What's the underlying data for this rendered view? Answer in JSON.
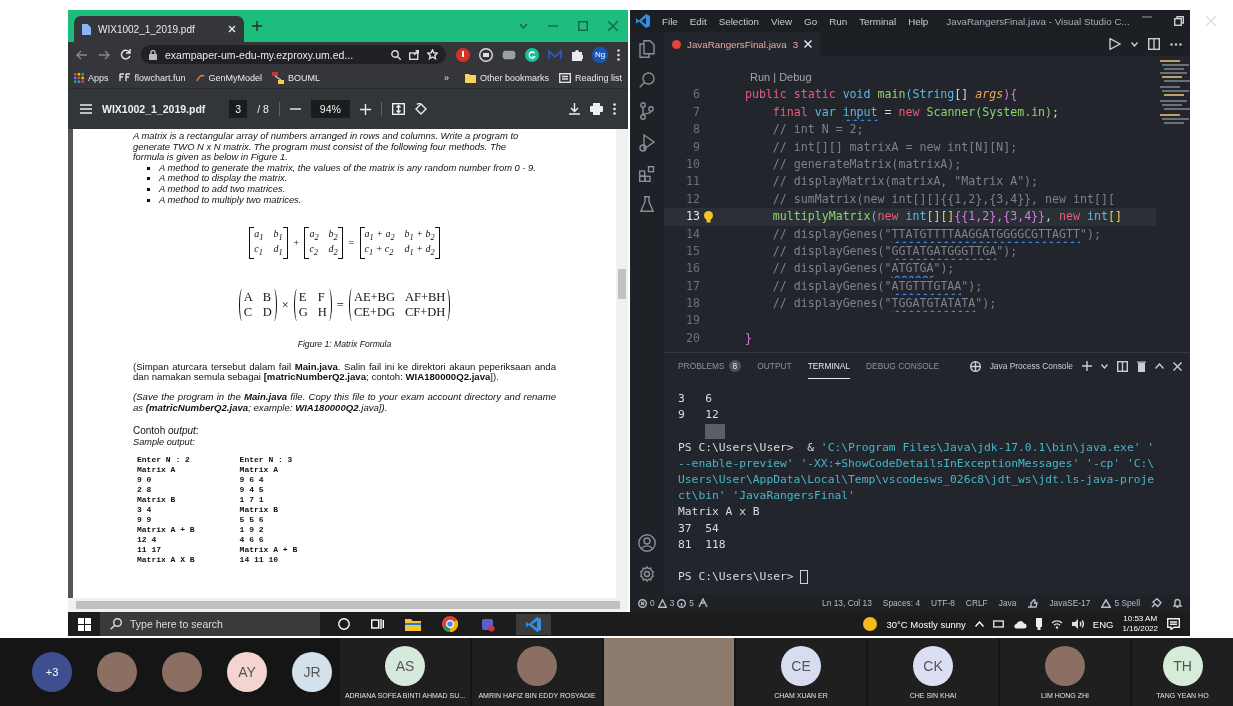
{
  "browser": {
    "tab_title": "WIX1002_1_2019.pdf",
    "url": "exampaper-um-edu-my.ezproxy.um.ed...",
    "profile": "Ng",
    "bookmarks": [
      {
        "label": "Apps",
        "kind": "apps"
      },
      {
        "label": "flowchart.fun",
        "kind": "ff"
      },
      {
        "label": "GenMyModel",
        "kind": "gen"
      },
      {
        "label": "BOUML",
        "kind": "bouml"
      }
    ],
    "overflow": "»",
    "bookmarks_right": [
      {
        "label": "Other bookmarks",
        "kind": "folder"
      },
      {
        "label": "Reading list",
        "kind": "reading"
      }
    ]
  },
  "pdf_toolbar": {
    "title": "WIX1002_1_2019.pdf",
    "page": "3",
    "page_total": "/ 8",
    "zoom": "94%"
  },
  "pdf_page": {
    "intro": [
      "A matrix is a rectangular array of numbers arranged in rows and columns. Write a program to",
      "generate TWO N x N matrix. The program must consist of the following four methods. The",
      "formula is given as below in Figure 1."
    ],
    "bullets": [
      "A method to generate the matrix, the values of the matrix is any random number from 0 - 9.",
      "A method to display the matrix.",
      "A method to add two matrices.",
      "A method to multiply two matrices."
    ],
    "formulas": [
      {
        "items": [
          {
            "kind": "bracket-matrix",
            "rows": [
              [
                "a$_{1}$",
                "b$_{1}$"
              ],
              [
                "c$_{1}$",
                "d$_{1}$"
              ]
            ]
          },
          {
            "kind": "op",
            "text": "+"
          },
          {
            "kind": "bracket-matrix",
            "rows": [
              [
                "a$_{2}$",
                "b$_{2}$"
              ],
              [
                "c$_{2}$",
                "d$_{2}$"
              ]
            ]
          },
          {
            "kind": "op",
            "text": "="
          },
          {
            "kind": "bracket-matrix",
            "rows": [
              [
                "a$_{1}$ + a$_{2}$",
                "b$_{1}$ + b$_{2}$"
              ],
              [
                "c$_{1}$ + c$_{2}$",
                "d$_{1}$ + d$_{2}$"
              ]
            ]
          }
        ]
      },
      {
        "items": [
          {
            "kind": "paren-matrix",
            "rows": [
              [
                "A",
                "B"
              ],
              [
                "C",
                "D"
              ]
            ]
          },
          {
            "kind": "op",
            "text": "×"
          },
          {
            "kind": "paren-matrix",
            "rows": [
              [
                "E",
                "F"
              ],
              [
                "G",
                "H"
              ]
            ]
          },
          {
            "kind": "op",
            "text": "="
          },
          {
            "kind": "paren-matrix",
            "rows": [
              [
                "AE+BG",
                "AF+BH"
              ],
              [
                "CE+DG",
                "CF+DH"
              ]
            ]
          }
        ]
      }
    ],
    "caption": "Figure 1: Matrix Formula",
    "malay": "(Simpan aturcara tersebut dalam fail **Main.java**.  Salin fail ini ke direktori akaun peperiksaan anda dan namakan semula sebagai **[matricNumberQ2.java**; contoh: **WIA180000Q2.java**]).",
    "english": "(Save the program in the **Main.java** file.  Copy this file to your exam account directory and rename as **(matricNumberQ2.java**; example: **WIA180000Q2**.java]).",
    "contoh": "Contoh *output*:",
    "sample_label": "Sample output:",
    "sample_columns": [
      [
        "Enter N : 2",
        "Matrix A",
        "9 0",
        "2 8",
        "Matrix B",
        "3 4",
        "9 9",
        "Matrix A + B",
        "12 4",
        "11 17",
        "Matrix A X B"
      ],
      [
        "Enter N : 3",
        "Matrix A",
        "9 6 4",
        "9 4 5",
        "1 7 1",
        "Matrix B",
        "5 5 6",
        "1 9 2",
        "4 6 6",
        "Matrix A + B",
        "14 11 10"
      ]
    ]
  },
  "vscode": {
    "menu": [
      "File",
      "Edit",
      "Selection",
      "View",
      "Go",
      "Run",
      "Terminal",
      "Help"
    ],
    "title": "JavaRangersFinal.java - Visual Studio C...",
    "tab": {
      "label": "JavaRangersFinal.java",
      "badge": "3"
    },
    "codelens": "Run | Debug",
    "lines": [
      {
        "number": "6",
        "current": false,
        "tokens": [
          {
            "text": "    public static ",
            "kind": "keyword"
          },
          {
            "text": "void ",
            "kind": "type"
          },
          {
            "text": "main",
            "kind": "function"
          },
          {
            "text": "(",
            "kind": "punct"
          },
          {
            "text": "String",
            "kind": "type"
          },
          {
            "text": "[] ",
            "kind": "plain"
          },
          {
            "text": "args",
            "kind": "param"
          },
          {
            "text": "){",
            "kind": "brace"
          }
        ]
      },
      {
        "number": "7",
        "current": false,
        "tokens": [
          {
            "text": "        final ",
            "kind": "keyword"
          },
          {
            "text": "var ",
            "kind": "type"
          },
          {
            "text": "input",
            "kind": "squiggly-var"
          },
          {
            "text": " = ",
            "kind": "plain"
          },
          {
            "text": "new ",
            "kind": "keyword"
          },
          {
            "text": "Scanner(System.in)",
            "kind": "function"
          },
          {
            "text": ";",
            "kind": "plain"
          }
        ]
      },
      {
        "number": "8",
        "current": false,
        "tokens": [
          {
            "text": "        // int N = 2;",
            "kind": "comment"
          }
        ]
      },
      {
        "number": "9",
        "current": false,
        "tokens": [
          {
            "text": "        // int[][] matrixA = new int[N][N];",
            "kind": "comment"
          }
        ]
      },
      {
        "number": "10",
        "current": false,
        "tokens": [
          {
            "text": "        // generateMatrix(matrixA);",
            "kind": "comment"
          }
        ]
      },
      {
        "number": "11",
        "current": false,
        "tokens": [
          {
            "text": "        // displayMatrix(matrixA, \"Matrix A\");",
            "kind": "comment"
          }
        ]
      },
      {
        "number": "12",
        "current": false,
        "tokens": [
          {
            "text": "        // sumMatrix(new int[][]{{1,2},{3,4}}, new int[][",
            "kind": "comment"
          }
        ]
      },
      {
        "number": "13",
        "current": true,
        "tokens": [
          {
            "text": "        multiplyMatrix",
            "kind": "function"
          },
          {
            "text": "(",
            "kind": "punct"
          },
          {
            "text": "new ",
            "kind": "keyword"
          },
          {
            "text": "int",
            "kind": "type"
          },
          {
            "text": "[][]",
            "kind": "bracket"
          },
          {
            "text": "{{1,2},{3,4}}",
            "kind": "brace"
          },
          {
            "text": ", ",
            "kind": "plain"
          },
          {
            "text": "new ",
            "kind": "keyword"
          },
          {
            "text": "int",
            "kind": "type"
          },
          {
            "text": "[]",
            "kind": "bracket"
          }
        ]
      },
      {
        "number": "14",
        "current": false,
        "tokens": [
          {
            "text": "        // displayGenes(\"",
            "kind": "comment"
          },
          {
            "text": "TTATGTTTTAAGGATGGGGCGTTAGTT",
            "kind": "squiggly-comment"
          },
          {
            "text": "\");",
            "kind": "comment"
          }
        ]
      },
      {
        "number": "15",
        "current": false,
        "tokens": [
          {
            "text": "        // displayGenes(\"",
            "kind": "comment"
          },
          {
            "text": "GGTATGATGGGTTGA",
            "kind": "squiggly-comment"
          },
          {
            "text": "\");",
            "kind": "comment"
          }
        ]
      },
      {
        "number": "16",
        "current": false,
        "tokens": [
          {
            "text": "        // displayGenes(\"",
            "kind": "comment"
          },
          {
            "text": "ATGTGA",
            "kind": "squiggly-comment"
          },
          {
            "text": "\");",
            "kind": "comment"
          }
        ]
      },
      {
        "number": "17",
        "current": false,
        "tokens": [
          {
            "text": "        // displayGenes(\"",
            "kind": "comment"
          },
          {
            "text": "ATGTTTGTAA",
            "kind": "squiggly-comment"
          },
          {
            "text": "\");",
            "kind": "comment"
          }
        ]
      },
      {
        "number": "18",
        "current": false,
        "tokens": [
          {
            "text": "        // displayGenes(\"",
            "kind": "comment"
          },
          {
            "text": "TGGATGTATATA",
            "kind": "squiggly-comment"
          },
          {
            "text": "\");",
            "kind": "comment"
          }
        ]
      },
      {
        "number": "19",
        "current": false
      },
      {
        "number": "20",
        "current": false,
        "tokens": [
          {
            "text": "    }",
            "kind": "brace"
          }
        ]
      }
    ],
    "panel_tabs": [
      {
        "label": "PROBLEMS",
        "badge": "8",
        "selected": false
      },
      {
        "label": "OUTPUT",
        "selected": false
      },
      {
        "label": "TERMINAL",
        "selected": true
      },
      {
        "label": "DEBUG CONSOLE",
        "selected": false
      }
    ],
    "terminal_name": "Java Process Console",
    "terminal": [
      {
        "kind": "text",
        "tokens": [
          {
            "text": "3   6",
            "kind": "out"
          }
        ]
      },
      {
        "kind": "text",
        "tokens": [
          {
            "text": "9   12",
            "kind": "out"
          }
        ]
      },
      {
        "kind": "highlight"
      },
      {
        "kind": "text",
        "tokens": [
          {
            "text": "PS C:\\Users\\User>  & ",
            "kind": "out"
          },
          {
            "text": "'C:\\Program Files\\Java\\jdk-17.0.1\\bin\\java.exe' '",
            "kind": "arg"
          }
        ]
      },
      {
        "kind": "text",
        "tokens": [
          {
            "text": "--enable-preview' '-XX:+ShowCodeDetailsInExceptionMessages' '-cp' 'C:\\",
            "kind": "arg"
          }
        ]
      },
      {
        "kind": "text",
        "tokens": [
          {
            "text": "Users\\User\\AppData\\Local\\Temp\\vscodesws_026c8\\jdt_ws\\jdt.ls-java-proje",
            "kind": "arg"
          }
        ]
      },
      {
        "kind": "text",
        "tokens": [
          {
            "text": "ct\\bin' 'JavaRangersFinal'",
            "kind": "arg"
          }
        ]
      },
      {
        "kind": "text",
        "tokens": [
          {
            "text": "Matrix A x B",
            "kind": "out"
          }
        ]
      },
      {
        "kind": "text",
        "tokens": [
          {
            "text": "37  54",
            "kind": "out"
          }
        ]
      },
      {
        "kind": "text",
        "tokens": [
          {
            "text": "81  118",
            "kind": "out"
          }
        ]
      },
      {
        "kind": "blank"
      },
      {
        "kind": "prompt",
        "tokens": [
          {
            "text": "PS C:\\Users\\User> ",
            "kind": "out"
          }
        ]
      }
    ],
    "status": {
      "errors": "0",
      "warnings": "3",
      "infos": "5",
      "right": [
        {
          "text": "Ln 13, Col 13",
          "kind": "text"
        },
        {
          "text": "Spaces: 4",
          "kind": "text"
        },
        {
          "text": "UTF-8",
          "kind": "text"
        },
        {
          "text": "CRLF",
          "kind": "text"
        },
        {
          "text": "Java",
          "kind": "text"
        },
        {
          "text": "JavaSE-17",
          "kind": "runtime"
        },
        {
          "text": "5 Spell",
          "kind": "warning"
        }
      ]
    }
  },
  "taskbar": {
    "search_placeholder": "Type here to search",
    "weather": "30°C  Mostly sunny",
    "language": "ENG",
    "time": "10:53 AM",
    "date": "1/16/2022"
  },
  "participants": {
    "small": [
      {
        "kind": "count",
        "label": "+3",
        "color": "#3d4f8f"
      },
      {
        "kind": "photo"
      },
      {
        "kind": "photo"
      },
      {
        "kind": "initials",
        "label": "AY",
        "color": "#f4d4d0"
      },
      {
        "kind": "initials",
        "label": "JR",
        "color": "#d3e2ea"
      }
    ],
    "tiles": [
      {
        "kind": "initials",
        "label": "AS",
        "name": "ADRIANA SOFEA BINTI AHMAD SU...",
        "color": "#d6e9dd"
      },
      {
        "kind": "photo",
        "name": "AMRIN HAFIZ BIN EDDY ROSYADIE"
      },
      {
        "kind": "video"
      },
      {
        "kind": "initials",
        "label": "CE",
        "name": "CHAM XUAN ER",
        "color": "#d7dcf1"
      },
      {
        "kind": "initials",
        "label": "CK",
        "name": "CHE SIN KHAI",
        "color": "#dcdff3"
      },
      {
        "kind": "photo",
        "name": "LIM HONG ZHI"
      },
      {
        "kind": "initials",
        "label": "TH",
        "name": "TANG YEAN HO",
        "color": "#d6ecd8"
      }
    ]
  }
}
